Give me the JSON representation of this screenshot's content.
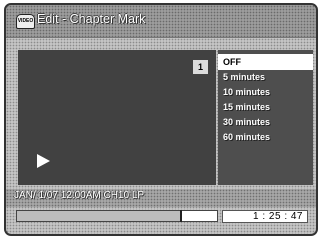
{
  "header": {
    "badge_label": "VIDEO",
    "title": "Edit - Chapter Mark"
  },
  "video": {
    "chapter_number": "1"
  },
  "menu": {
    "items": [
      {
        "label": "OFF",
        "selected": true
      },
      {
        "label": "5 minutes",
        "selected": false
      },
      {
        "label": "10 minutes",
        "selected": false
      },
      {
        "label": "15 minutes",
        "selected": false
      },
      {
        "label": "30 minutes",
        "selected": false
      },
      {
        "label": "60 minutes",
        "selected": false
      }
    ]
  },
  "status": {
    "info": "JAN/ 1/07 12:00AM CH10   LP"
  },
  "playback": {
    "progress_fraction": 0.82,
    "time": "1 : 25 : 47"
  },
  "icons": {
    "play": "play-icon",
    "badge": "video-badge-icon"
  }
}
